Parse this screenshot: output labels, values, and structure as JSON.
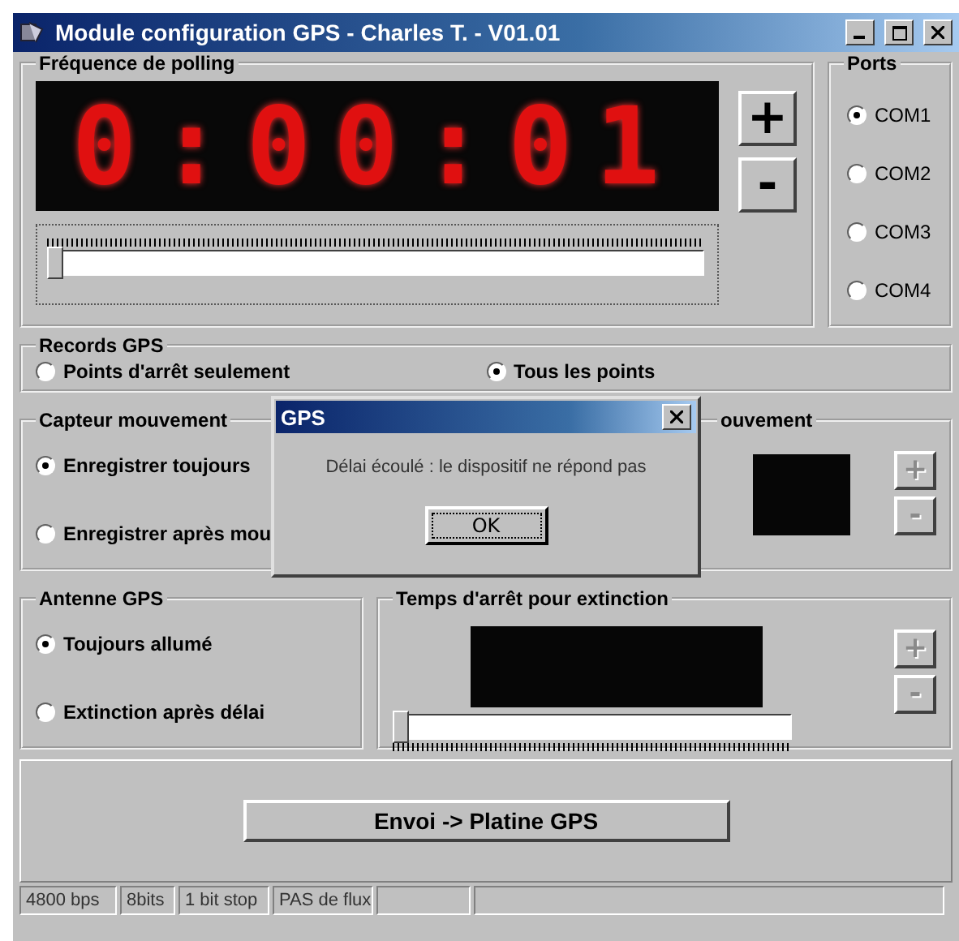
{
  "window": {
    "title": "Module configuration GPS - Charles T. - V01.01"
  },
  "polling": {
    "title": "Fréquence de polling",
    "display": "0:00:01",
    "buttons": [
      {
        "label": "+",
        "disabled": false
      },
      {
        "label": "-",
        "disabled": false
      }
    ],
    "slider": {
      "level": 0
    }
  },
  "ports": {
    "title": "Ports",
    "options": [
      {
        "label": "COM1",
        "selected": true
      },
      {
        "label": "COM2",
        "selected": false
      },
      {
        "label": "COM3",
        "selected": false
      },
      {
        "label": "COM4",
        "selected": false
      }
    ]
  },
  "records": {
    "title": "Records GPS",
    "options": [
      {
        "label": "Points d'arrêt seulement",
        "selected": false
      },
      {
        "label": "Tous les points",
        "selected": true
      }
    ]
  },
  "capteur": {
    "title": "Capteur mouvement",
    "options": [
      {
        "label": "Enregistrer toujours",
        "selected": true
      },
      {
        "label": "Enregistrer après mou",
        "selected": false
      }
    ]
  },
  "mouvement_delay": {
    "title": "ouvement",
    "buttons": [
      {
        "label": "+",
        "disabled": true
      },
      {
        "label": "-",
        "disabled": true
      }
    ]
  },
  "antenne": {
    "title": "Antenne GPS",
    "options": [
      {
        "label": "Toujours allumé",
        "selected": true
      },
      {
        "label": "Extinction après délai",
        "selected": false
      }
    ]
  },
  "extinction": {
    "title": "Temps d'arrêt pour extinction",
    "buttons": [
      {
        "label": "+",
        "disabled": true
      },
      {
        "label": "-",
        "disabled": true
      }
    ],
    "slider": {
      "level": 0
    }
  },
  "send_button": "Envoi -> Platine GPS",
  "status_bar": [
    "4800 bps",
    "8bits",
    "1 bit stop",
    "PAS de flux"
  ],
  "dialog": {
    "title": "GPS",
    "message": "Délai écoulé : le dispositif ne répond pas",
    "button": "OK"
  }
}
